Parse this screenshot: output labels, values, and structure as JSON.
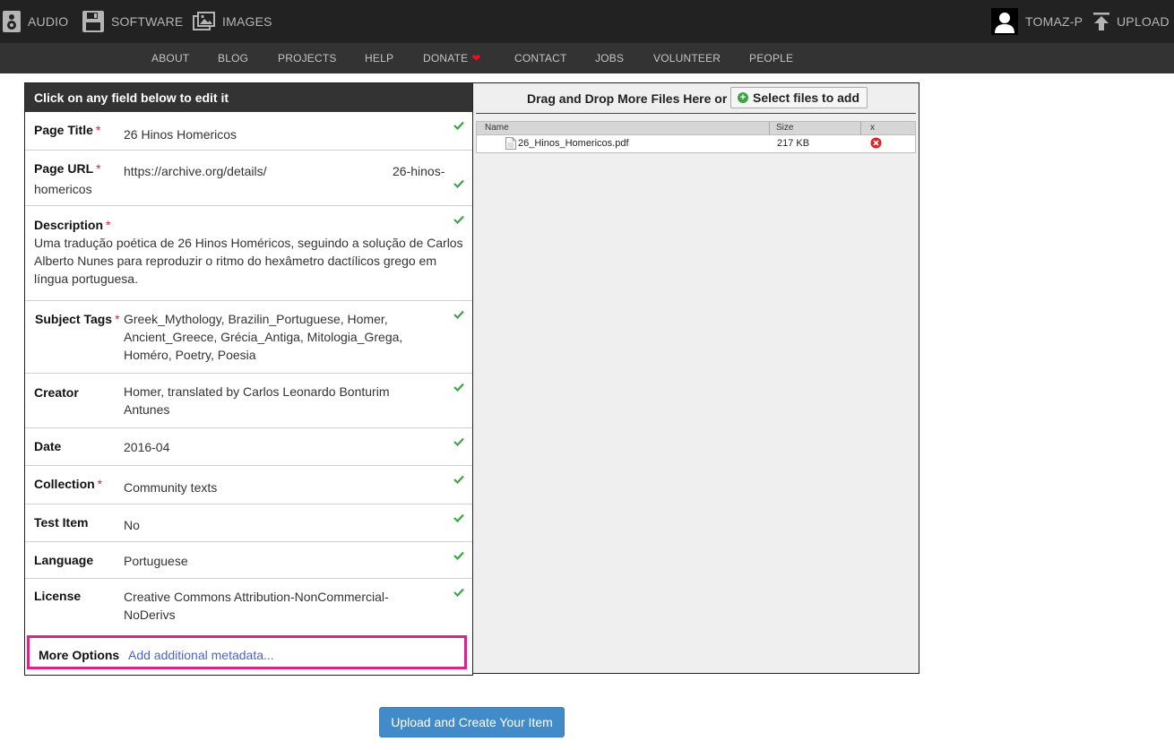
{
  "topbar": {
    "audio": "AUDIO",
    "software": "SOFTWARE",
    "images": "IMAGES",
    "user": "TOMAZ-P",
    "upload": "UPLOAD"
  },
  "subnav": {
    "about": "ABOUT",
    "blog": "BLOG",
    "projects": "PROJECTS",
    "help": "HELP",
    "donate": "DONATE",
    "contact": "CONTACT",
    "jobs": "JOBS",
    "volunteer": "VOLUNTEER",
    "people": "PEOPLE"
  },
  "form": {
    "header": "Click on any field below to edit it",
    "required_mark": "*",
    "page_title": {
      "label": "Page Title",
      "value": "26 Hinos Homericos"
    },
    "page_url": {
      "label": "Page URL",
      "prefix": "https://archive.org/details/",
      "slug_a": "26-hinos-",
      "slug_b": "homericos"
    },
    "description": {
      "label": "Description",
      "value": "Uma tradução poética de 26 Hinos Homéricos, seguindo a solução de Carlos Alberto Nunes para reproduzir o ritmo do hexâmetro dactílicos grego em língua portuguesa."
    },
    "subject_tags": {
      "label": "Subject Tags",
      "value": "Greek_Mythology, Brazilin_Portuguese, Homer, Ancient_Greece, Grécia_Antiga, Mitologia_Grega, Homéro, Poetry, Poesia"
    },
    "creator": {
      "label": "Creator",
      "value": "Homer, translated by Carlos Leonardo Bonturim Antunes"
    },
    "date": {
      "label": "Date",
      "value": "2016-04"
    },
    "collection": {
      "label": "Collection",
      "value": "Community texts"
    },
    "test_item": {
      "label": "Test Item",
      "value": "No"
    },
    "language": {
      "label": "Language",
      "value": "Portuguese"
    },
    "license": {
      "label": "License",
      "value": "Creative Commons Attribution-NonCommercial-NoDerivs"
    },
    "more_options": {
      "label": "More Options",
      "link": "Add additional metadata..."
    }
  },
  "files": {
    "drop_text": "Drag and Drop More Files Here or",
    "select_button": "Select files to add",
    "columns": {
      "name": "Name",
      "size": "Size",
      "remove": "x"
    },
    "rows": [
      {
        "name": "26_Hinos_Homericos.pdf",
        "size": "217 KB"
      }
    ]
  },
  "upload_button": "Upload and Create Your Item",
  "colors": {
    "topbar": "#222222",
    "subnav": "#333333",
    "required": "#d9242b",
    "check": "#3aa640",
    "highlight": "#d8258c",
    "link": "#4a64c6",
    "primary_button": "#428bca"
  }
}
